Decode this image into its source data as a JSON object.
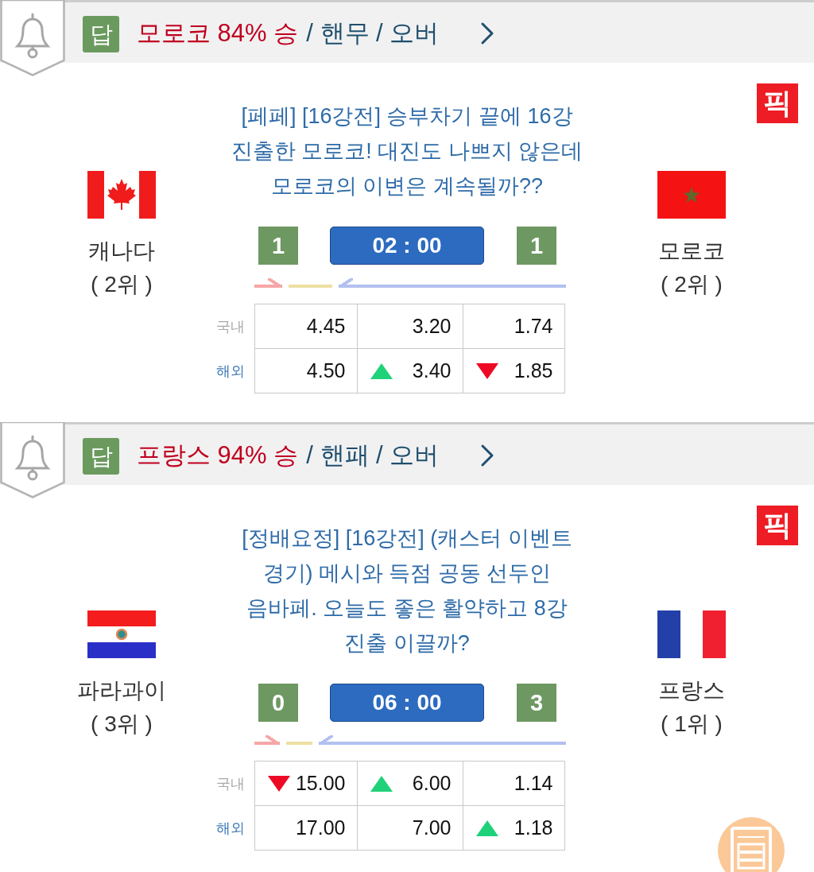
{
  "matches": [
    {
      "answer": {
        "badge": "답",
        "result": "모로코 84% 승",
        "details": "/ 핸무 / 오버"
      },
      "pick_badge": "픽",
      "title": "[페페] [16강전] 승부차기 끝에 16강 진출한 모로코! 대진도 나쁘지 않은데 모로코의 이변은 계속될까??",
      "home": {
        "flag": {
          "kind": "canada"
        },
        "name": "캐나다",
        "rank": "( 2위 )"
      },
      "away": {
        "flag": {
          "kind": "morocco"
        },
        "name": "모로코",
        "rank": "( 2위 )"
      },
      "home_score": "1",
      "time": "02 : 00",
      "away_score": "1",
      "odds": [
        {
          "kind": "domestic",
          "label": "국내",
          "cells": [
            {
              "kind": "plain",
              "value": "4.45"
            },
            {
              "kind": "plain",
              "value": "3.20"
            },
            {
              "kind": "plain",
              "value": "1.74"
            }
          ]
        },
        {
          "kind": "overseas",
          "label": "해외",
          "cells": [
            {
              "kind": "plain",
              "value": "4.50"
            },
            {
              "kind": "up",
              "value": "3.40"
            },
            {
              "kind": "down",
              "value": "1.85"
            }
          ]
        }
      ]
    },
    {
      "answer": {
        "badge": "답",
        "result": "프랑스 94% 승",
        "details": "/ 핸패 / 오버"
      },
      "pick_badge": "픽",
      "title": "[정배요정] [16강전] (캐스터 이벤트 경기) 메시와 득점 공동 선두인 음바페. 오늘도 좋은 활약하고 8강 진출 이끌까?",
      "home": {
        "flag": {
          "kind": "paraguay"
        },
        "name": "파라과이",
        "rank": "( 3위 )"
      },
      "away": {
        "flag": {
          "kind": "france"
        },
        "name": "프랑스",
        "rank": "( 1위 )"
      },
      "home_score": "0",
      "time": "06 : 00",
      "away_score": "3",
      "odds": [
        {
          "kind": "domestic",
          "label": "국내",
          "cells": [
            {
              "kind": "down",
              "value": "15.00"
            },
            {
              "kind": "up",
              "value": "6.00"
            },
            {
              "kind": "plain",
              "value": "1.14"
            }
          ]
        },
        {
          "kind": "overseas",
          "label": "해외",
          "cells": [
            {
              "kind": "plain",
              "value": "17.00"
            },
            {
              "kind": "plain",
              "value": "7.00"
            },
            {
              "kind": "up",
              "value": "1.18"
            }
          ]
        }
      ]
    }
  ]
}
